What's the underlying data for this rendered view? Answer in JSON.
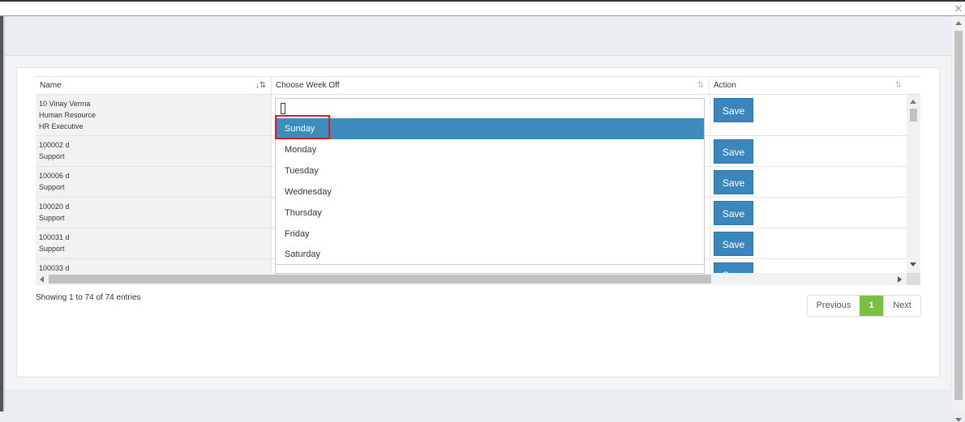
{
  "window": {
    "close_glyph": "✕"
  },
  "table": {
    "headers": {
      "name": "Name",
      "week_off": "Choose Week Off",
      "action": "Action"
    },
    "rows": [
      {
        "lines": [
          "10 Vinay Verma",
          "Human Resource",
          "HR Executive"
        ],
        "action": "Save"
      },
      {
        "lines": [
          "100002 d",
          "Support"
        ],
        "action": "Save"
      },
      {
        "lines": [
          "100006 d",
          "Support"
        ],
        "action": "Save"
      },
      {
        "lines": [
          "100020 d",
          "Support"
        ],
        "action": "Save"
      },
      {
        "lines": [
          "100031 d",
          "Support"
        ],
        "action": "Save"
      },
      {
        "lines": [
          "100033 d"
        ],
        "action": "Save"
      }
    ]
  },
  "dropdown": {
    "search_value": "",
    "selected": "Sunday",
    "options": [
      "Sunday",
      "Monday",
      "Tuesday",
      "Wednesday",
      "Thursday",
      "Friday",
      "Saturday"
    ]
  },
  "footer": {
    "info": "Showing 1 to 74 of 74 entries",
    "pagination": {
      "previous": "Previous",
      "current": "1",
      "next": "Next"
    }
  },
  "colors": {
    "primary": "#3b87bd",
    "selected_option": "#3d8dbc",
    "active_page": "#7ac043",
    "highlight": "#e0191f"
  }
}
